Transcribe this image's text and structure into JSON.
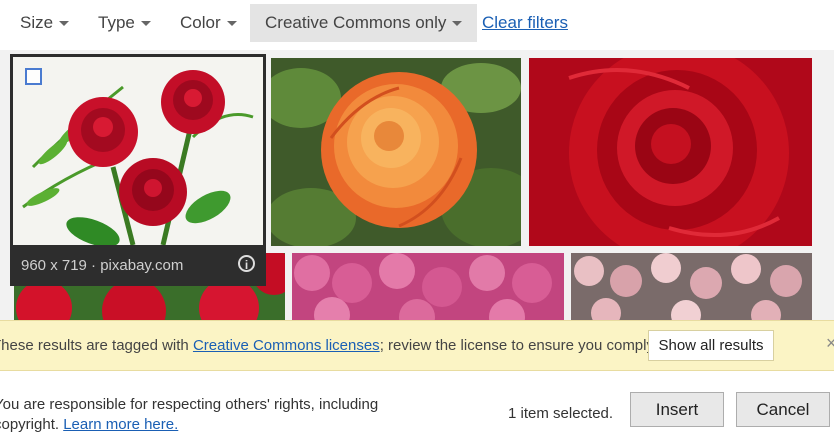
{
  "filters": {
    "size": "Size",
    "type": "Type",
    "color": "Color",
    "license": "Creative Commons only",
    "clear": "Clear filters"
  },
  "selected_image": {
    "meta": "960 x 719 · pixabay.com",
    "info_icon": "i"
  },
  "notice": {
    "prefix": "These results are tagged with ",
    "link": "Creative Commons licenses",
    "suffix": "; review the license to ensure you comply.",
    "show_all": "Show all results",
    "close": "×"
  },
  "footer": {
    "rights_line1": "You are responsible for respecting others' rights, including",
    "rights_line2": "copyright. ",
    "learn_more": "Learn more here.",
    "selected_count": "1 item selected.",
    "insert": "Insert",
    "cancel": "Cancel"
  },
  "icons": {
    "caret": "chevron-down-icon",
    "info": "info-icon",
    "close": "close-icon"
  },
  "colors": {
    "link": "#1a5fb4",
    "notice_bg": "#fbf4c5",
    "selected_frame": "#2d2d2d"
  }
}
